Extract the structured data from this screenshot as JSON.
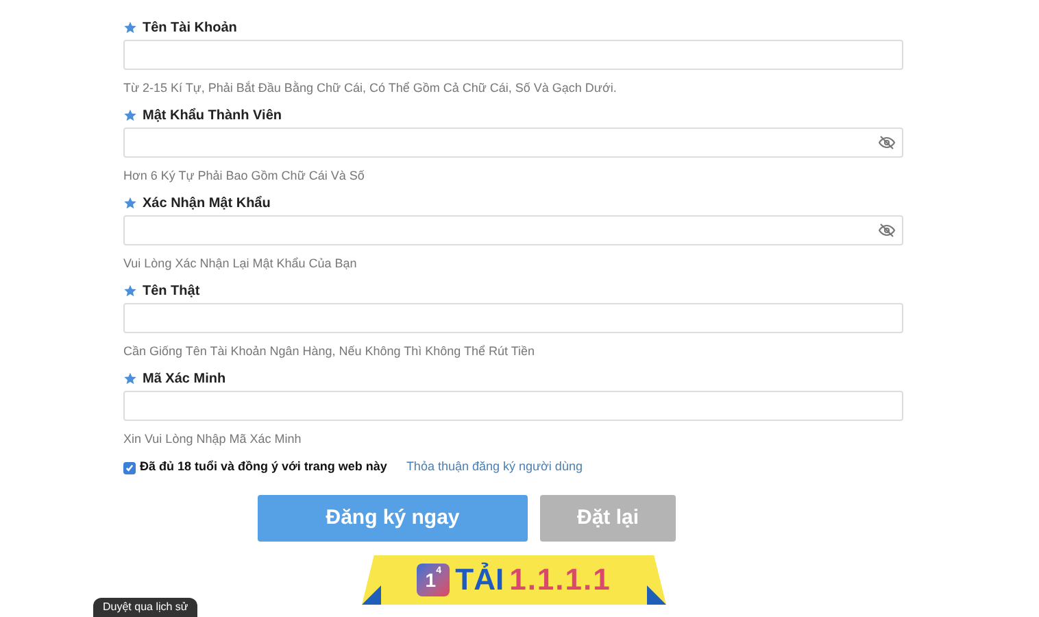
{
  "fields": [
    {
      "label": "Tên Tài Khoản",
      "kind": "text",
      "hint": "Từ 2-15 Kí Tự, Phải Bắt Đầu Bằng Chữ Cái, Có Thể Gồm Cả Chữ Cái, Số Và Gạch Dưới."
    },
    {
      "label": "Mật Khẩu Thành Viên",
      "kind": "password",
      "hint": "Hơn 6 Ký Tự Phải Bao Gồm Chữ Cái Và Số"
    },
    {
      "label": "Xác Nhận Mật Khẩu",
      "kind": "password",
      "hint": "Vui Lòng Xác Nhận Lại Mật Khẩu Của Bạn"
    },
    {
      "label": "Tên Thật",
      "kind": "text",
      "hint": "Cần Giống Tên Tài Khoản Ngân Hàng, Nếu Không Thì Không Thể Rút Tiền"
    },
    {
      "label": "Mã Xác Minh",
      "kind": "text",
      "hint": "Xin Vui Lòng Nhập Mã Xác Minh"
    }
  ],
  "agreement": {
    "checked": true,
    "label": "Đã đủ 18 tuổi và đồng ý với trang web này",
    "link": "Thỏa thuận đăng ký người dùng"
  },
  "buttons": [
    {
      "label": "Đăng ký ngay",
      "kind": "primary"
    },
    {
      "label": "Đặt lại",
      "kind": "secondary"
    }
  ],
  "banner": {
    "icon_text": "1",
    "icon_sup": "4",
    "word": "TẢI",
    "version": "1.1.1.1"
  },
  "history_tab": {
    "label": "Duyệt qua lịch sử"
  }
}
